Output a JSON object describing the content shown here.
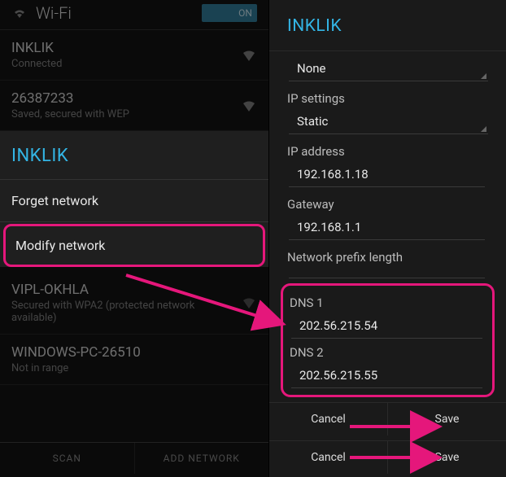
{
  "left": {
    "header": {
      "title": "Wi-Fi",
      "toggle": "ON"
    },
    "networks": [
      {
        "name": "INKLIK",
        "sub": "Connected"
      },
      {
        "name": "26387233",
        "sub": "Saved, secured with WEP"
      }
    ],
    "dialog": {
      "title": "INKLIK",
      "forget": "Forget network",
      "modify": "Modify network"
    },
    "networks2": [
      {
        "name": "VIPL-OKHLA",
        "sub": "Secured with WPA2 (protected network available)"
      },
      {
        "name": "WINDOWS-PC-26510",
        "sub": "Not in range"
      }
    ],
    "bottom": {
      "scan": "SCAN",
      "add": "ADD NETWORK"
    }
  },
  "right": {
    "title": "INKLIK",
    "proxy_value": "None",
    "ip_settings_label": "IP settings",
    "ip_settings_value": "Static",
    "ip_address_label": "IP address",
    "ip_address_value": "192.168.1.18",
    "gateway_label": "Gateway",
    "gateway_value": "192.168.1.1",
    "prefix_label": "Network prefix length",
    "prefix_value": "",
    "dns1_label": "DNS 1",
    "dns1_value": "202.56.215.54",
    "dns2_label": "DNS 2",
    "dns2_value": "202.56.215.55",
    "cancel": "Cancel",
    "save": "Save"
  }
}
